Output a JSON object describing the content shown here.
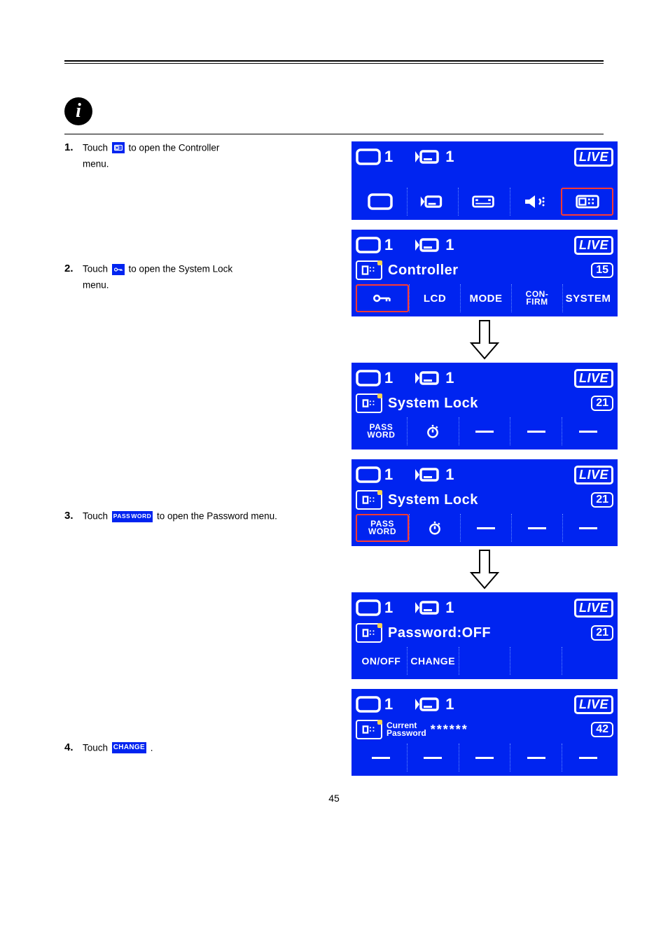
{
  "page_number": "45",
  "inline_labels": {
    "passwd_line1": "PASS",
    "passwd_line2": "WORD",
    "change": "CHANGE"
  },
  "steps": [
    {
      "num": "1.",
      "textA": "Touch ",
      "textB": " to open the Controller",
      "textC": "menu."
    },
    {
      "num": "2.",
      "textA": "Touch ",
      "textB": " to open the System Lock",
      "textC": "menu."
    },
    {
      "num": "3.",
      "textA": "Touch ",
      "textB": " to open the Password menu."
    },
    {
      "num": "4.",
      "textA": "Touch ",
      "textB": "."
    }
  ],
  "lcd": {
    "live": "LIVE",
    "one": "1",
    "screens": {
      "controller": {
        "title": "Controller",
        "page": "15",
        "tabs": [
          "",
          "LCD",
          "MODE",
          "CON-\nFIRM",
          "SYSTEM"
        ]
      },
      "syslock": {
        "title": "System Lock",
        "page": "21",
        "tabs_pass_l1": "PASS",
        "tabs_pass_l2": "WORD"
      },
      "password": {
        "title": "Password:OFF",
        "page": "21",
        "tabs": [
          "ON/OFF",
          "CHANGE"
        ]
      },
      "current": {
        "title_l1": "Current",
        "title_l2": "Password",
        "stars": "******",
        "page": "42"
      }
    }
  }
}
